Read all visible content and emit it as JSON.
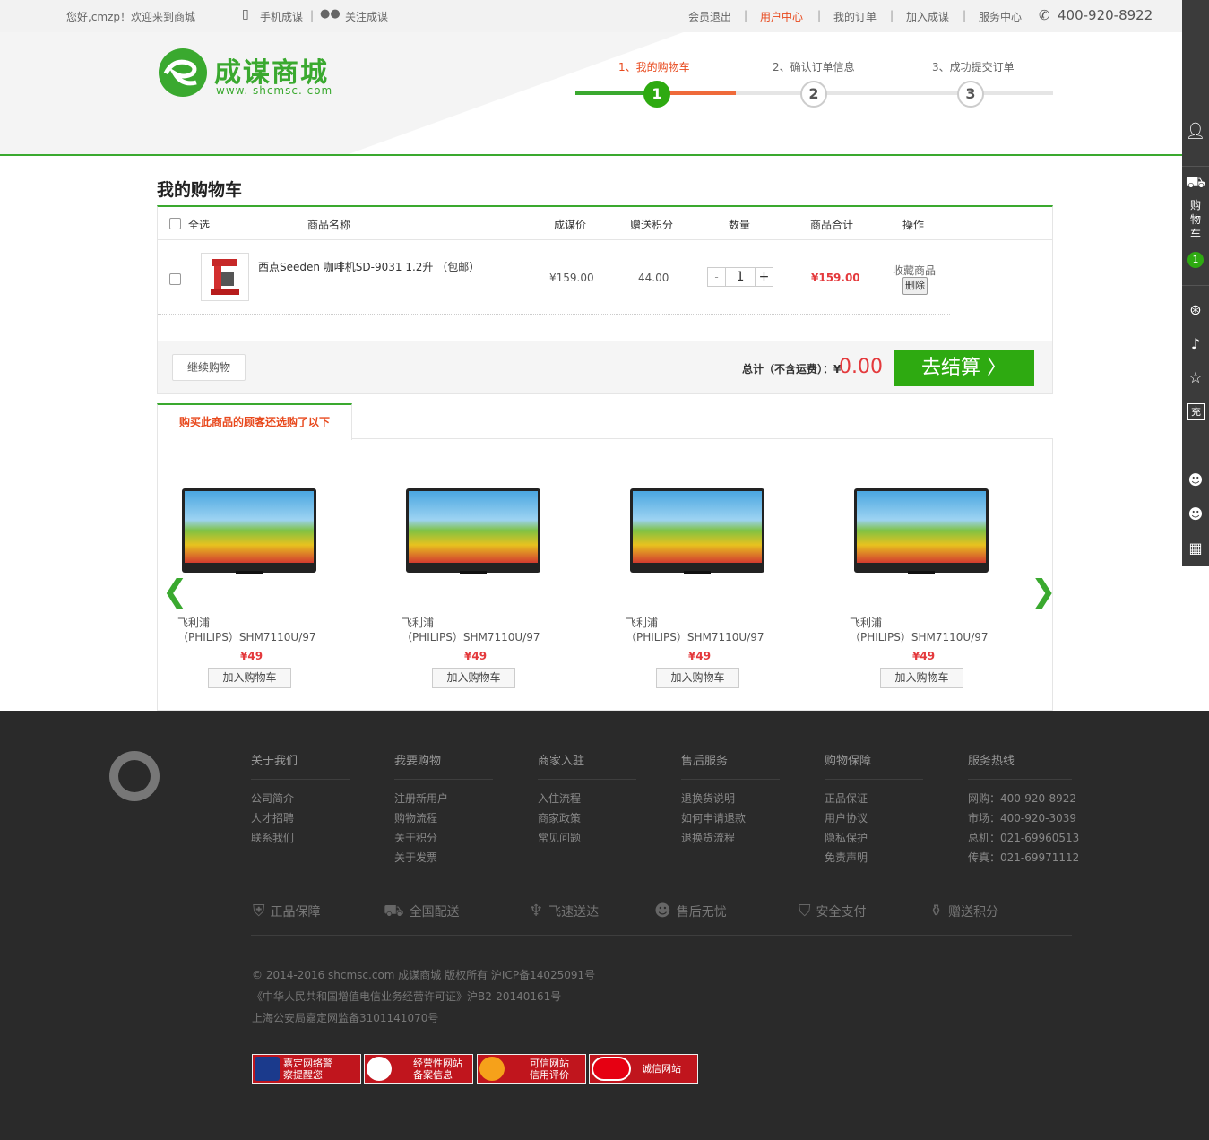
{
  "topbar": {
    "welcome": "您好,cmzp！欢迎来到商城",
    "mobile": "手机成谋",
    "follow": "关注成谋",
    "logout": "会员退出",
    "user_center": "用户中心",
    "my_orders": "我的订单",
    "join": "加入成谋",
    "service": "服务中心",
    "phone": "400-920-8922"
  },
  "logo": {
    "name": "成谋商城",
    "url": "www. shcmsc. com"
  },
  "steps": [
    {
      "label": "1、我的购物车",
      "num": "1"
    },
    {
      "label": "2、确认订单信息",
      "num": "2"
    },
    {
      "label": "3、成功提交订单",
      "num": "3"
    }
  ],
  "cart": {
    "title": "我的购物车",
    "headers": {
      "select_all": "全选",
      "name": "商品名称",
      "price": "成谋价",
      "points": "赠送积分",
      "qty": "数量",
      "subtotal": "商品合计",
      "action": "操作"
    },
    "item": {
      "name": "西点Seeden 咖啡机SD-9031 1.2升 （包邮）",
      "price": "¥159.00",
      "points": "44.00",
      "qty": "1",
      "minus": "-",
      "plus": "+",
      "subtotal": "¥159.00",
      "favorite": "收藏商品",
      "delete": "删除"
    },
    "continue": "继续购物",
    "total_label": "总计（不含运费）：¥",
    "total_value": "0.00",
    "checkout": "去结算 〉"
  },
  "recommend": {
    "tab": "购买此商品的顾客还选购了以下",
    "prev": "❮",
    "next": "❯",
    "products": [
      {
        "line1": "飞利浦",
        "line2": "（PHILIPS）SHM7110U/97",
        "price": "¥49",
        "button": "加入购物车"
      },
      {
        "line1": "飞利浦",
        "line2": "（PHILIPS）SHM7110U/97",
        "price": "¥49",
        "button": "加入购物车"
      },
      {
        "line1": "飞利浦",
        "line2": "（PHILIPS）SHM7110U/97",
        "price": "¥49",
        "button": "加入购物车"
      },
      {
        "line1": "飞利浦",
        "line2": "（PHILIPS）SHM7110U/97",
        "price": "¥49",
        "button": "加入购物车"
      }
    ]
  },
  "sidebar": {
    "cart_label": "购物车",
    "cart_count": "1",
    "recharge": "充"
  },
  "footer": {
    "columns": [
      {
        "title": "关于我们",
        "items": [
          "公司简介",
          "人才招聘",
          "联系我们"
        ]
      },
      {
        "title": "我要购物",
        "items": [
          "注册新用户",
          "购物流程",
          "关于积分",
          "关于发票"
        ]
      },
      {
        "title": "商家入驻",
        "items": [
          "入住流程",
          "商家政策",
          "常见问题"
        ]
      },
      {
        "title": "售后服务",
        "items": [
          "退换货说明",
          "如何申请退款",
          "退换货流程"
        ]
      },
      {
        "title": "购物保障",
        "items": [
          "正品保证",
          "用户协议",
          "隐私保护",
          "免责声明"
        ]
      },
      {
        "title": "服务热线",
        "items": [
          "网购：400-920-8922",
          "市场：400-920-3039",
          "总机：021-69960513",
          "传真：021-69971112"
        ]
      }
    ],
    "guarantees": [
      "正品保障",
      "全国配送",
      "飞速送达",
      "售后无忧",
      "安全支付",
      "赠送积分"
    ],
    "copyright": [
      "© 2014-2016 shcmsc.com 成谋商城 版权所有 沪ICP备14025091号",
      "《中华人民共和国增值电信业务经营许可证》沪B2-20140161号",
      "上海公安局嘉定网监备3101141070号"
    ],
    "badges": [
      {
        "l1": "嘉定网络警",
        "l2": "察提醒您"
      },
      {
        "l1": "经营性网站",
        "l2": "备案信息"
      },
      {
        "l1": "可信网站",
        "l2": "信用评价"
      },
      {
        "l1": "诚信网站",
        "l2": ""
      }
    ]
  },
  "colors": {
    "green": "#3aa92f",
    "orange": "#e8491d",
    "red": "#e4393c",
    "dark": "#2a2a2a"
  }
}
